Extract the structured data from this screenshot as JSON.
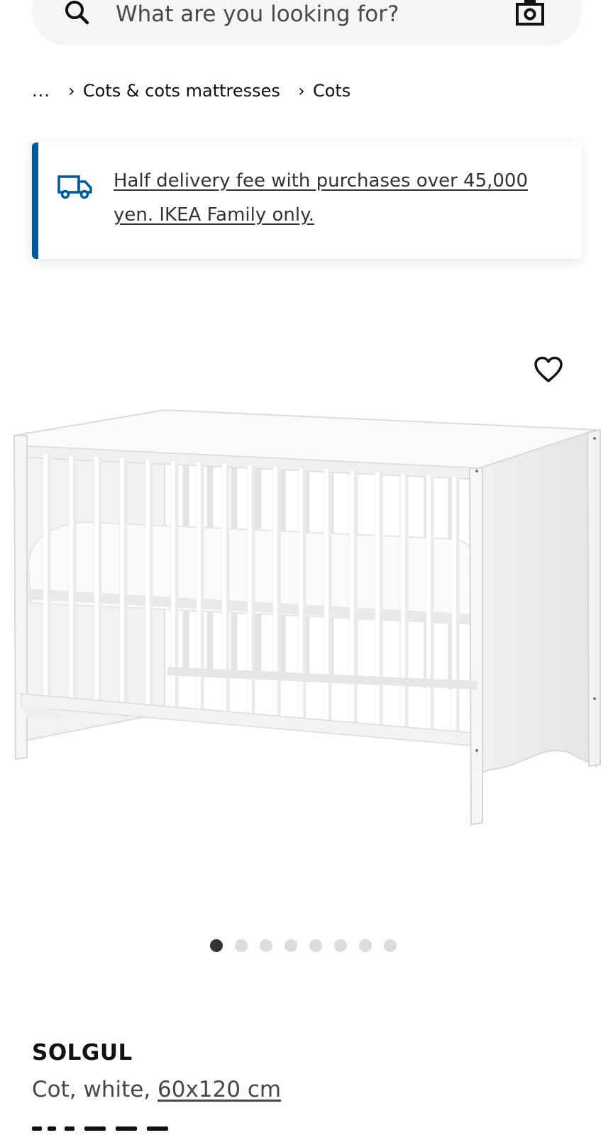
{
  "search": {
    "placeholder": "What are you looking for?"
  },
  "breadcrumb": {
    "ellipsis": "...",
    "items": [
      {
        "label": "Cots & cots mattresses"
      },
      {
        "label": "Cots"
      }
    ],
    "separator": "›"
  },
  "promo": {
    "text": "Half delivery fee with purchases over 45,000 yen. IKEA Family only.",
    "accent_color": "#0058a3"
  },
  "gallery": {
    "dot_count": 8,
    "active_index": 0
  },
  "product": {
    "name": "SOLGUL",
    "description_prefix": "Cot, white, ",
    "size": "60x120 cm"
  },
  "icons": {
    "search": "search-icon",
    "camera": "camera-icon",
    "truck": "truck-icon",
    "favorite": "heart-icon"
  }
}
